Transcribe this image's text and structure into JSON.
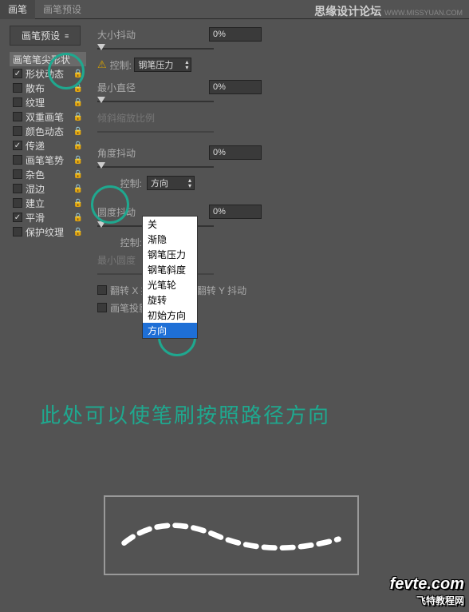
{
  "header": {
    "tab1": "画笔",
    "tab2": "画笔预设"
  },
  "watermark": {
    "title": "思缘设计论坛",
    "url": "WWW.MISSYUAN.COM"
  },
  "presetBtn": "画笔预设",
  "sidebar": {
    "shapeHeader": "画笔笔尖形状",
    "items": [
      {
        "label": "形状动态",
        "checked": true
      },
      {
        "label": "散布",
        "checked": false
      },
      {
        "label": "纹理",
        "checked": false
      },
      {
        "label": "双重画笔",
        "checked": false
      },
      {
        "label": "颜色动态",
        "checked": false
      },
      {
        "label": "传递",
        "checked": true
      },
      {
        "label": "画笔笔势",
        "checked": false
      },
      {
        "label": "杂色",
        "checked": false
      },
      {
        "label": "湿边",
        "checked": false
      },
      {
        "label": "建立",
        "checked": false
      },
      {
        "label": "平滑",
        "checked": true
      },
      {
        "label": "保护纹理",
        "checked": false
      }
    ]
  },
  "content": {
    "sizeJitter": "大小抖动",
    "sizeJitterVal": "0%",
    "control": "控制:",
    "penPressure": "钢笔压力",
    "minDiameter": "最小直径",
    "minDiameterVal": "0%",
    "tiltScale": "倾斜缩放比例",
    "angleJitter": "角度抖动",
    "angleJitterVal": "0%",
    "control2": "控制:",
    "direction": "方向",
    "roundJitter": "圆度抖动",
    "roundJitterVal": "0%",
    "control3": "控制:",
    "minRound": "最小圆度",
    "flipX": "翻转 X 抖动",
    "flipY": "翻转 Y 抖动",
    "brushProj": "画笔投影"
  },
  "dropdown": {
    "options": [
      "关",
      "渐隐",
      "钢笔压力",
      "钢笔斜度",
      "光笔轮",
      "旋转",
      "初始方向",
      "方向"
    ]
  },
  "annotation": "此处可以使笔刷按照路径方向",
  "fevte": {
    "main": "fevte.com",
    "sub": "飞特教程网"
  }
}
